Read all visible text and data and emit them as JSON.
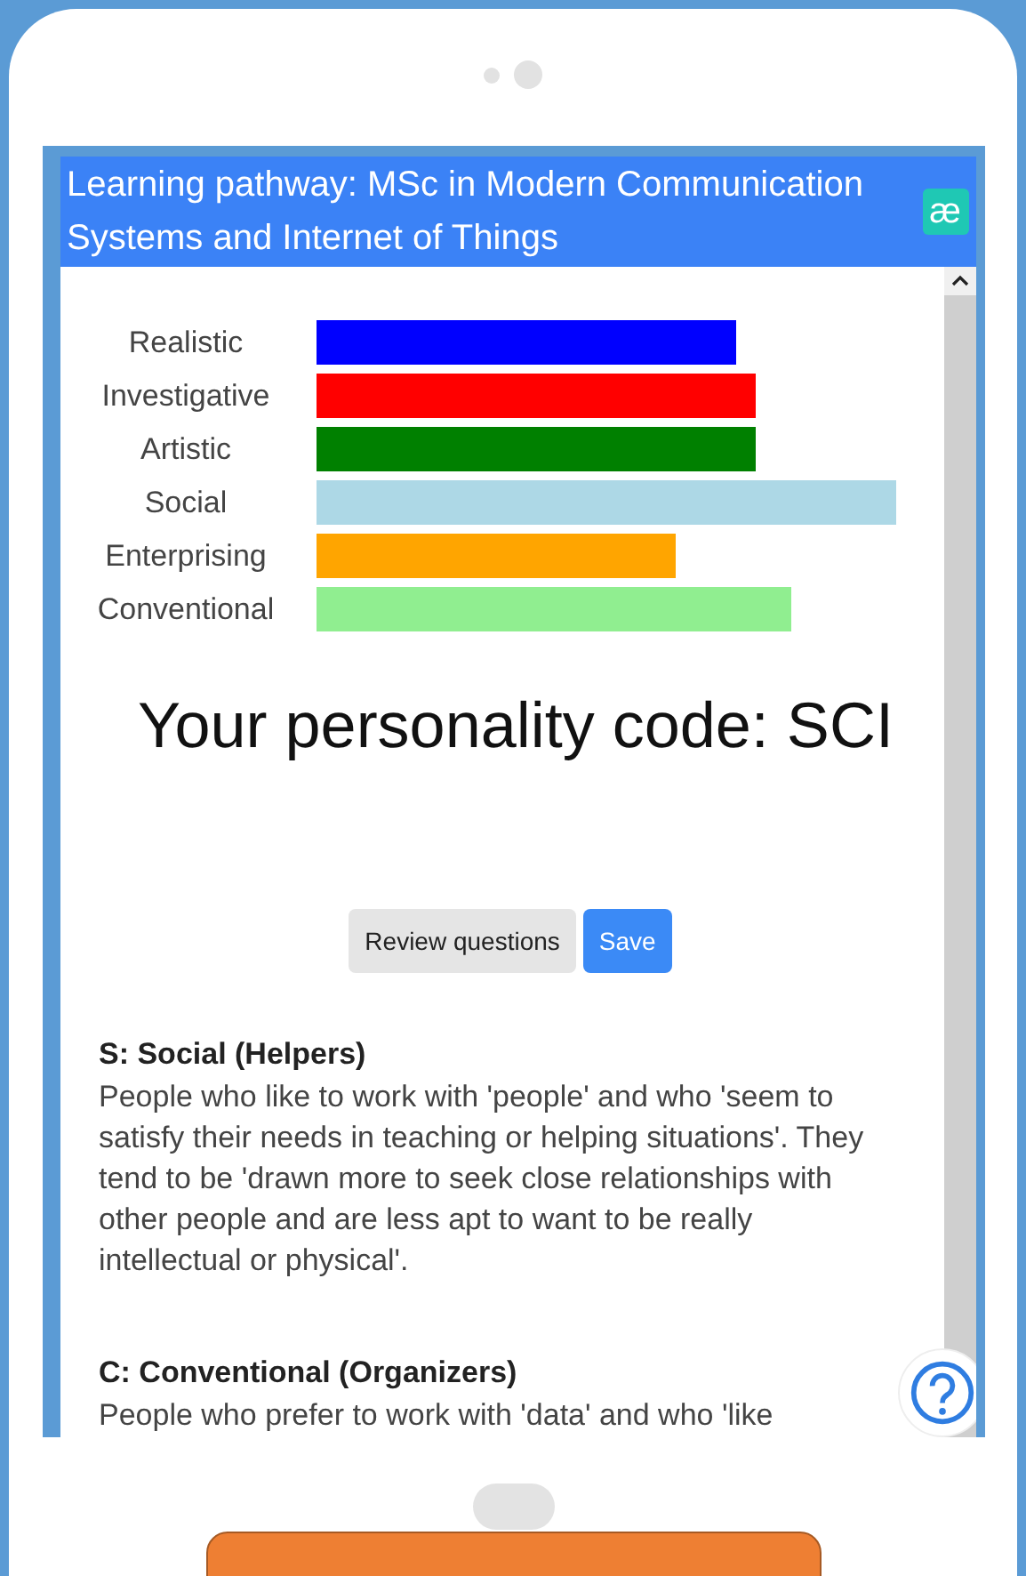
{
  "header": {
    "title": "Learning pathway: MSc in Modern Communication Systems and Internet of Things",
    "logo": "æ"
  },
  "traits": [
    {
      "label": "Realistic",
      "kind": "picture"
    },
    {
      "label": "Investigative",
      "kind": "picture"
    },
    {
      "label": "Artistic",
      "kind": "picture"
    },
    {
      "label": "Social",
      "kind": "picture"
    },
    {
      "label": "Enterprising",
      "kind": "picture"
    },
    {
      "label": "Conventional",
      "kind": "picture"
    }
  ],
  "code_heading": "Your personality code: SCI",
  "buttons": [
    {
      "label": "Review questions",
      "kind": "secondary"
    },
    {
      "label": "Save",
      "kind": "primary"
    }
  ],
  "descriptions": [
    {
      "heading": "S: Social (Helpers)",
      "text": "People who like to work with 'people' and who 'seem to satisfy their needs in teaching or helping situations'. They tend to be 'drawn more to seek close relationships with other people and are less apt to want to be really intellectual or physical'."
    },
    {
      "heading": "C: Conventional (Organizers)",
      "text": "People who prefer to work with 'data' and who 'like"
    }
  ]
}
